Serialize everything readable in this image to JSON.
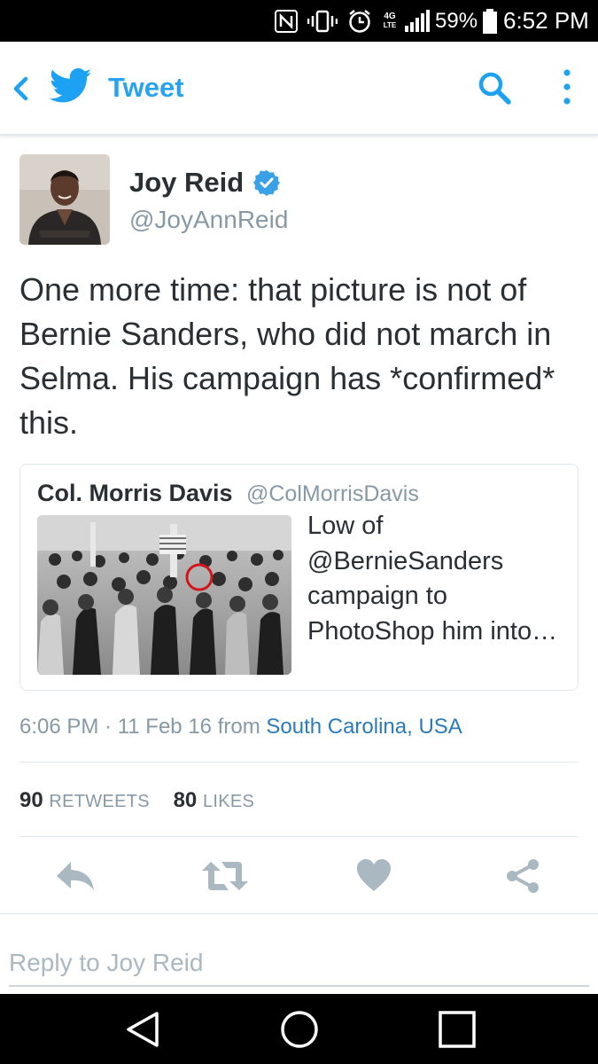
{
  "status_bar": {
    "network": "4G",
    "network_sub": "LTE",
    "battery_percent": "59%",
    "time": "6:52 PM",
    "icons": [
      "nfc-icon",
      "vibrate-icon",
      "alarm-icon",
      "signal-icon",
      "battery-icon"
    ]
  },
  "toolbar": {
    "title": "Tweet",
    "icons": [
      "back-chevron-icon",
      "twitter-bird-icon",
      "search-icon",
      "more-vertical-icon"
    ],
    "accent_color": "#1da1f2"
  },
  "tweet": {
    "author_name": "Joy Reid",
    "author_handle": "@JoyAnnReid",
    "verified": true,
    "text": "One more time: that picture is not of Bernie Sanders, who did not march in Selma. His campaign has *confirmed* this.",
    "timestamp": "6:06 PM · 11 Feb 16",
    "source_prefix": "from",
    "location": "South Carolina, USA",
    "retweets_count": "90",
    "retweets_label": "RETWEETS",
    "likes_count": "80",
    "likes_label": "LIKES"
  },
  "quoted_tweet": {
    "author_name": "Col. Morris Davis",
    "author_handle": "@ColMorrisDavis",
    "text": "Low of @BernieSanders campaign to PhotoShop him into…"
  },
  "actions": {
    "icons": [
      "reply-icon",
      "retweet-icon",
      "like-heart-icon",
      "share-icon"
    ]
  },
  "reply": {
    "placeholder": "Reply to Joy Reid"
  },
  "nav_bar": {
    "icons": [
      "nav-back-icon",
      "nav-home-icon",
      "nav-recents-icon"
    ]
  }
}
